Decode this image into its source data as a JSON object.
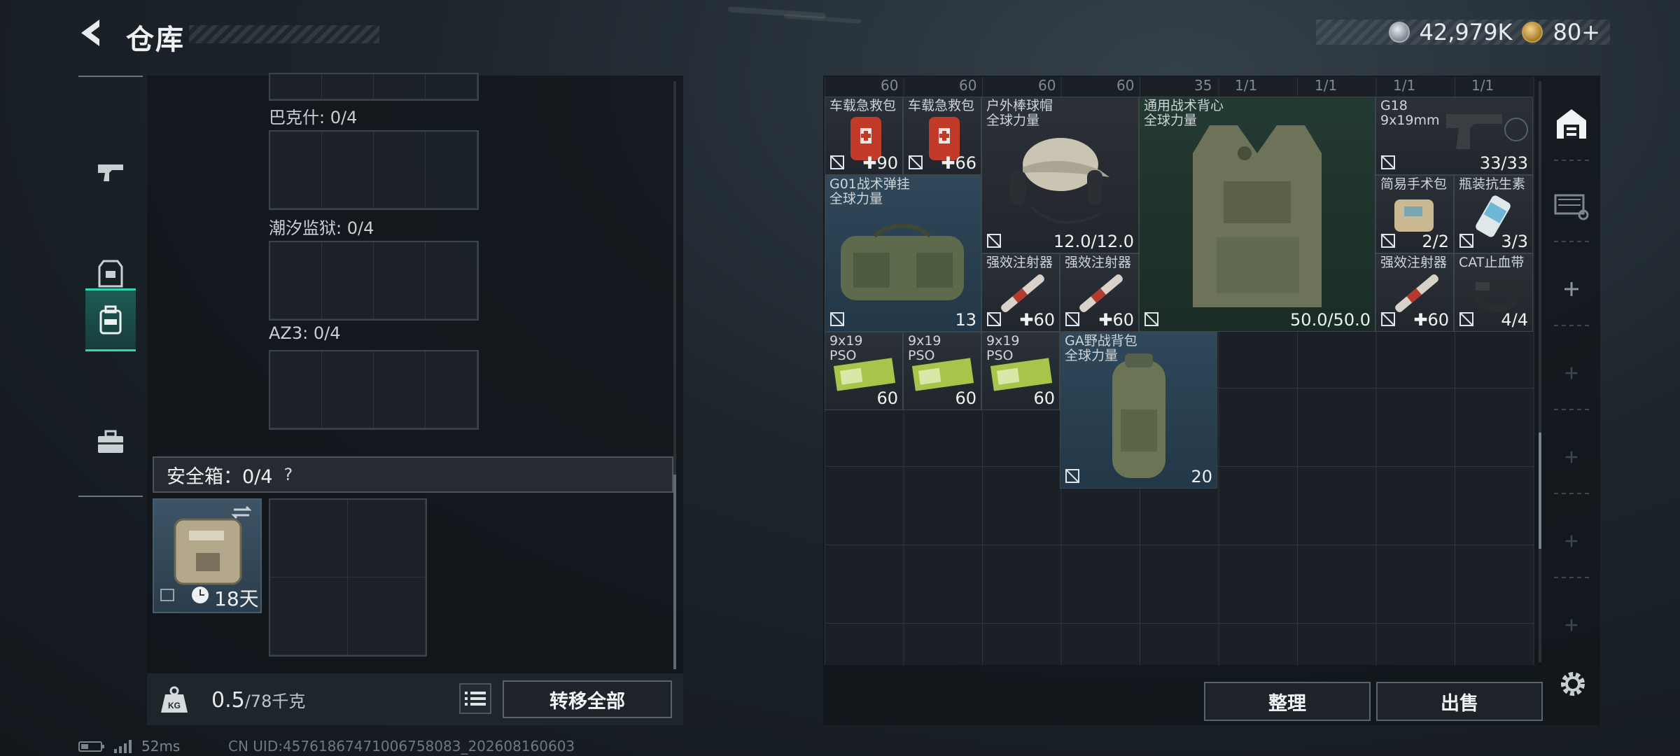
{
  "header": {
    "title": "仓库",
    "currency_silver": "42,979K",
    "currency_gold": "80+"
  },
  "left": {
    "zones": [
      {
        "label": "巴克什: 0/4"
      },
      {
        "label": "潮汐监狱: 0/4"
      },
      {
        "label": "AZ3: 0/4"
      }
    ],
    "safe_box": {
      "label": "安全箱：0/4",
      "help": "?",
      "timer": "18天"
    },
    "weight": {
      "current": "0.5",
      "max": "/78千克"
    },
    "transfer_all": "转移全部"
  },
  "status": {
    "latency": "52ms",
    "uid": "CN UID:457618674710067580​83_202608160603"
  },
  "stash": {
    "top_strip": [
      "60",
      "60",
      "60",
      "60",
      "35",
      "1/1",
      "1/1",
      "1/1",
      "1/1"
    ],
    "items": [
      {
        "name": "车载急救包",
        "count": "✚90"
      },
      {
        "name": "车载急救包",
        "count": "✚66"
      },
      {
        "name": "户外棒球帽\n全球力量",
        "count": "12.0/12.0"
      },
      {
        "name": "通用战术背心\n全球力量",
        "count": "50.0/50.0"
      },
      {
        "name": "G18\n9x19mm",
        "count": "33/33"
      },
      {
        "name": "G01战术弹挂\n全球力量",
        "count": "13"
      },
      {
        "name": "简易手术包",
        "count": "2/2"
      },
      {
        "name": "瓶装抗生素",
        "count": "3/3"
      },
      {
        "name": "强效注射器",
        "count": "✚60"
      },
      {
        "name": "强效注射器",
        "count": "✚60"
      },
      {
        "name": "强效注射器",
        "count": "✚60"
      },
      {
        "name": "CAT止血带",
        "count": "4/4"
      },
      {
        "name": "9x19\nPSO",
        "count": "60"
      },
      {
        "name": "9x19\nPSO",
        "count": "60"
      },
      {
        "name": "9x19\nPSO",
        "count": "60"
      },
      {
        "name": "GA野战背包\n全球力量",
        "count": "20"
      }
    ],
    "sort_label": "整理",
    "sell_label": "出售"
  },
  "colors": {
    "accent": "#2fd7b0",
    "panel": "#11161b",
    "item_blue": "#30485a"
  }
}
